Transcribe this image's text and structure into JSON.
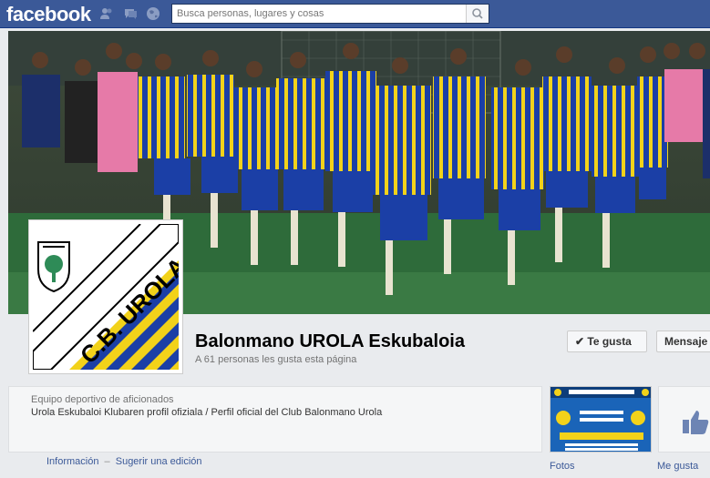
{
  "topbar": {
    "logo": "facebook",
    "search_placeholder": "Busca personas, lugares y cosas"
  },
  "page": {
    "name": "Balonmano UROLA Eskubaloia",
    "likes_text": "A 61 personas les gusta esta página",
    "like_button_label": "Te gusta",
    "message_button_label": "Mensaje",
    "category": "Equipo deportivo de aficionados",
    "description": "Urola Eskubaloi Klubaren profil ofiziala / Perfil oficial del Club Balonmano Urola"
  },
  "profile_logo": {
    "text": "C.B. UROLA E.T."
  },
  "tabs": {
    "info": "Información",
    "separator": "·",
    "suggest": "Sugerir una edición"
  },
  "apps": {
    "photos_label": "Fotos",
    "likes_label": "Me gusta"
  },
  "colors": {
    "brand": "#3b5998",
    "jersey_blue": "#1b3fa6",
    "jersey_yellow": "#f2d21a"
  }
}
